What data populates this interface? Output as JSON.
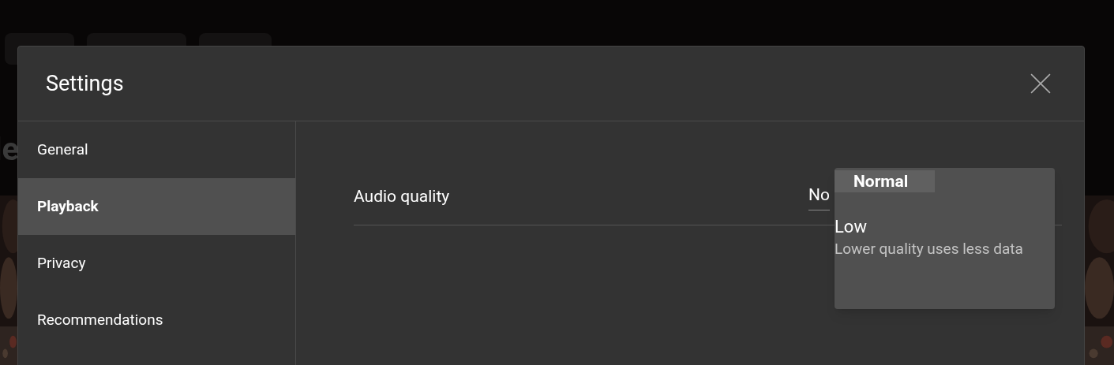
{
  "background": {
    "heading_fragment": "le",
    "chips": [
      {
        "kind": "chip"
      },
      {
        "kind": "chip"
      },
      {
        "kind": "chip"
      }
    ]
  },
  "dialog": {
    "title": "Settings"
  },
  "sidebar": {
    "items": [
      {
        "label": "General",
        "selected": false
      },
      {
        "label": "Playback",
        "selected": true
      },
      {
        "label": "Privacy",
        "selected": false
      },
      {
        "label": "Recommendations",
        "selected": false
      }
    ]
  },
  "setting": {
    "label": "Audio quality",
    "value": "No"
  },
  "menu": {
    "options": [
      {
        "label": "Normal",
        "selected": true
      },
      {
        "label": "Low",
        "description": "Lower quality uses less data",
        "selected": false
      }
    ]
  }
}
